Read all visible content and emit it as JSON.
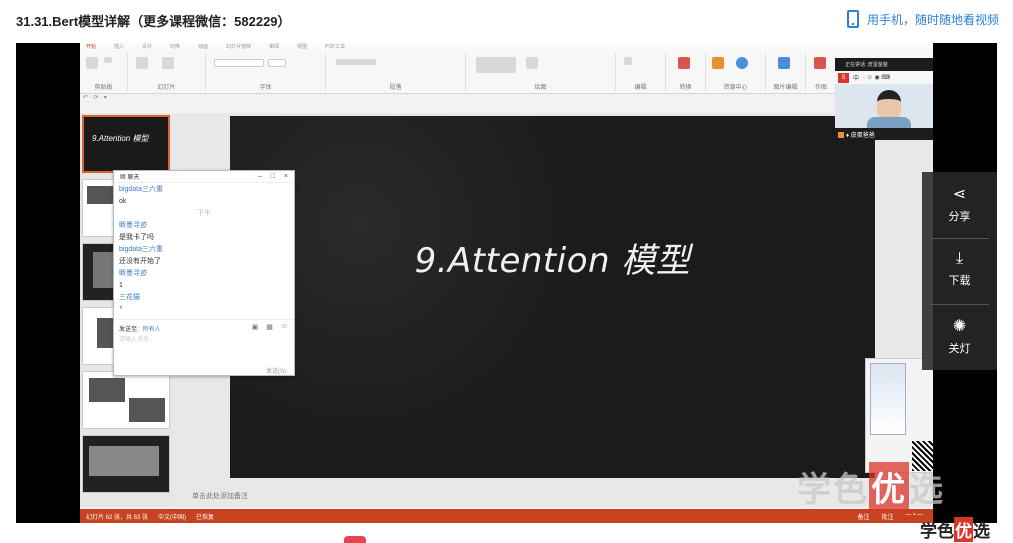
{
  "header": {
    "course_title": "31.31.Bert模型详解（更多课程微信：582229）",
    "mobile_link": "用手机，随时随地看视频"
  },
  "ppt": {
    "slide_title": "9.Attention 模型",
    "thumb_title": "9.Attention 模型",
    "notes_placeholder": "单击此处添加备注",
    "status_left": "幻灯片 62 张，共 63 张",
    "status_lang": "中文(中国)",
    "status_mode": "已恢复",
    "status_notes": "备注",
    "status_comments": "批注",
    "ribbon_groups": [
      "剪贴板",
      "幻灯片",
      "字体",
      "段落",
      "绘图",
      "编辑",
      "转换",
      "资源中心",
      "图片编辑",
      "作图"
    ],
    "ribbon_tabs": [
      "开始",
      "插入",
      "设计",
      "切换",
      "动画",
      "幻灯片放映",
      "审阅",
      "视图",
      "PDF工具"
    ]
  },
  "chat": {
    "title": "聊天",
    "messages": [
      {
        "user": "bigdata三六重",
        "text": "ok"
      },
      {
        "time": "下午"
      },
      {
        "user": "断墨寻迹",
        "text": "是我卡了吗"
      },
      {
        "user": "bigdata三六重",
        "text": "还没有开始了"
      },
      {
        "user": "断墨寻迹",
        "text": "1"
      },
      {
        "user": "三花猫",
        "text": "1"
      }
    ],
    "send_to_label": "发送至:",
    "send_to_value": "所有人",
    "input_placeholder": "请输入消息...",
    "send_button": "发送(S)"
  },
  "live": {
    "status": "正在讲话: 皮蛋爸爸",
    "presenter_name": "皮蛋爸爸",
    "toolbar_label": "中"
  },
  "side_panel": {
    "share": "分享",
    "download": "下载",
    "lights_off": "关灯"
  },
  "watermark": {
    "part1": "学",
    "part2": "色",
    "highlight": "优",
    "part3": "选"
  },
  "colors": {
    "accent_blue": "#2f7fd8",
    "status_red": "#c7421e",
    "brand_red": "#d9362b"
  }
}
